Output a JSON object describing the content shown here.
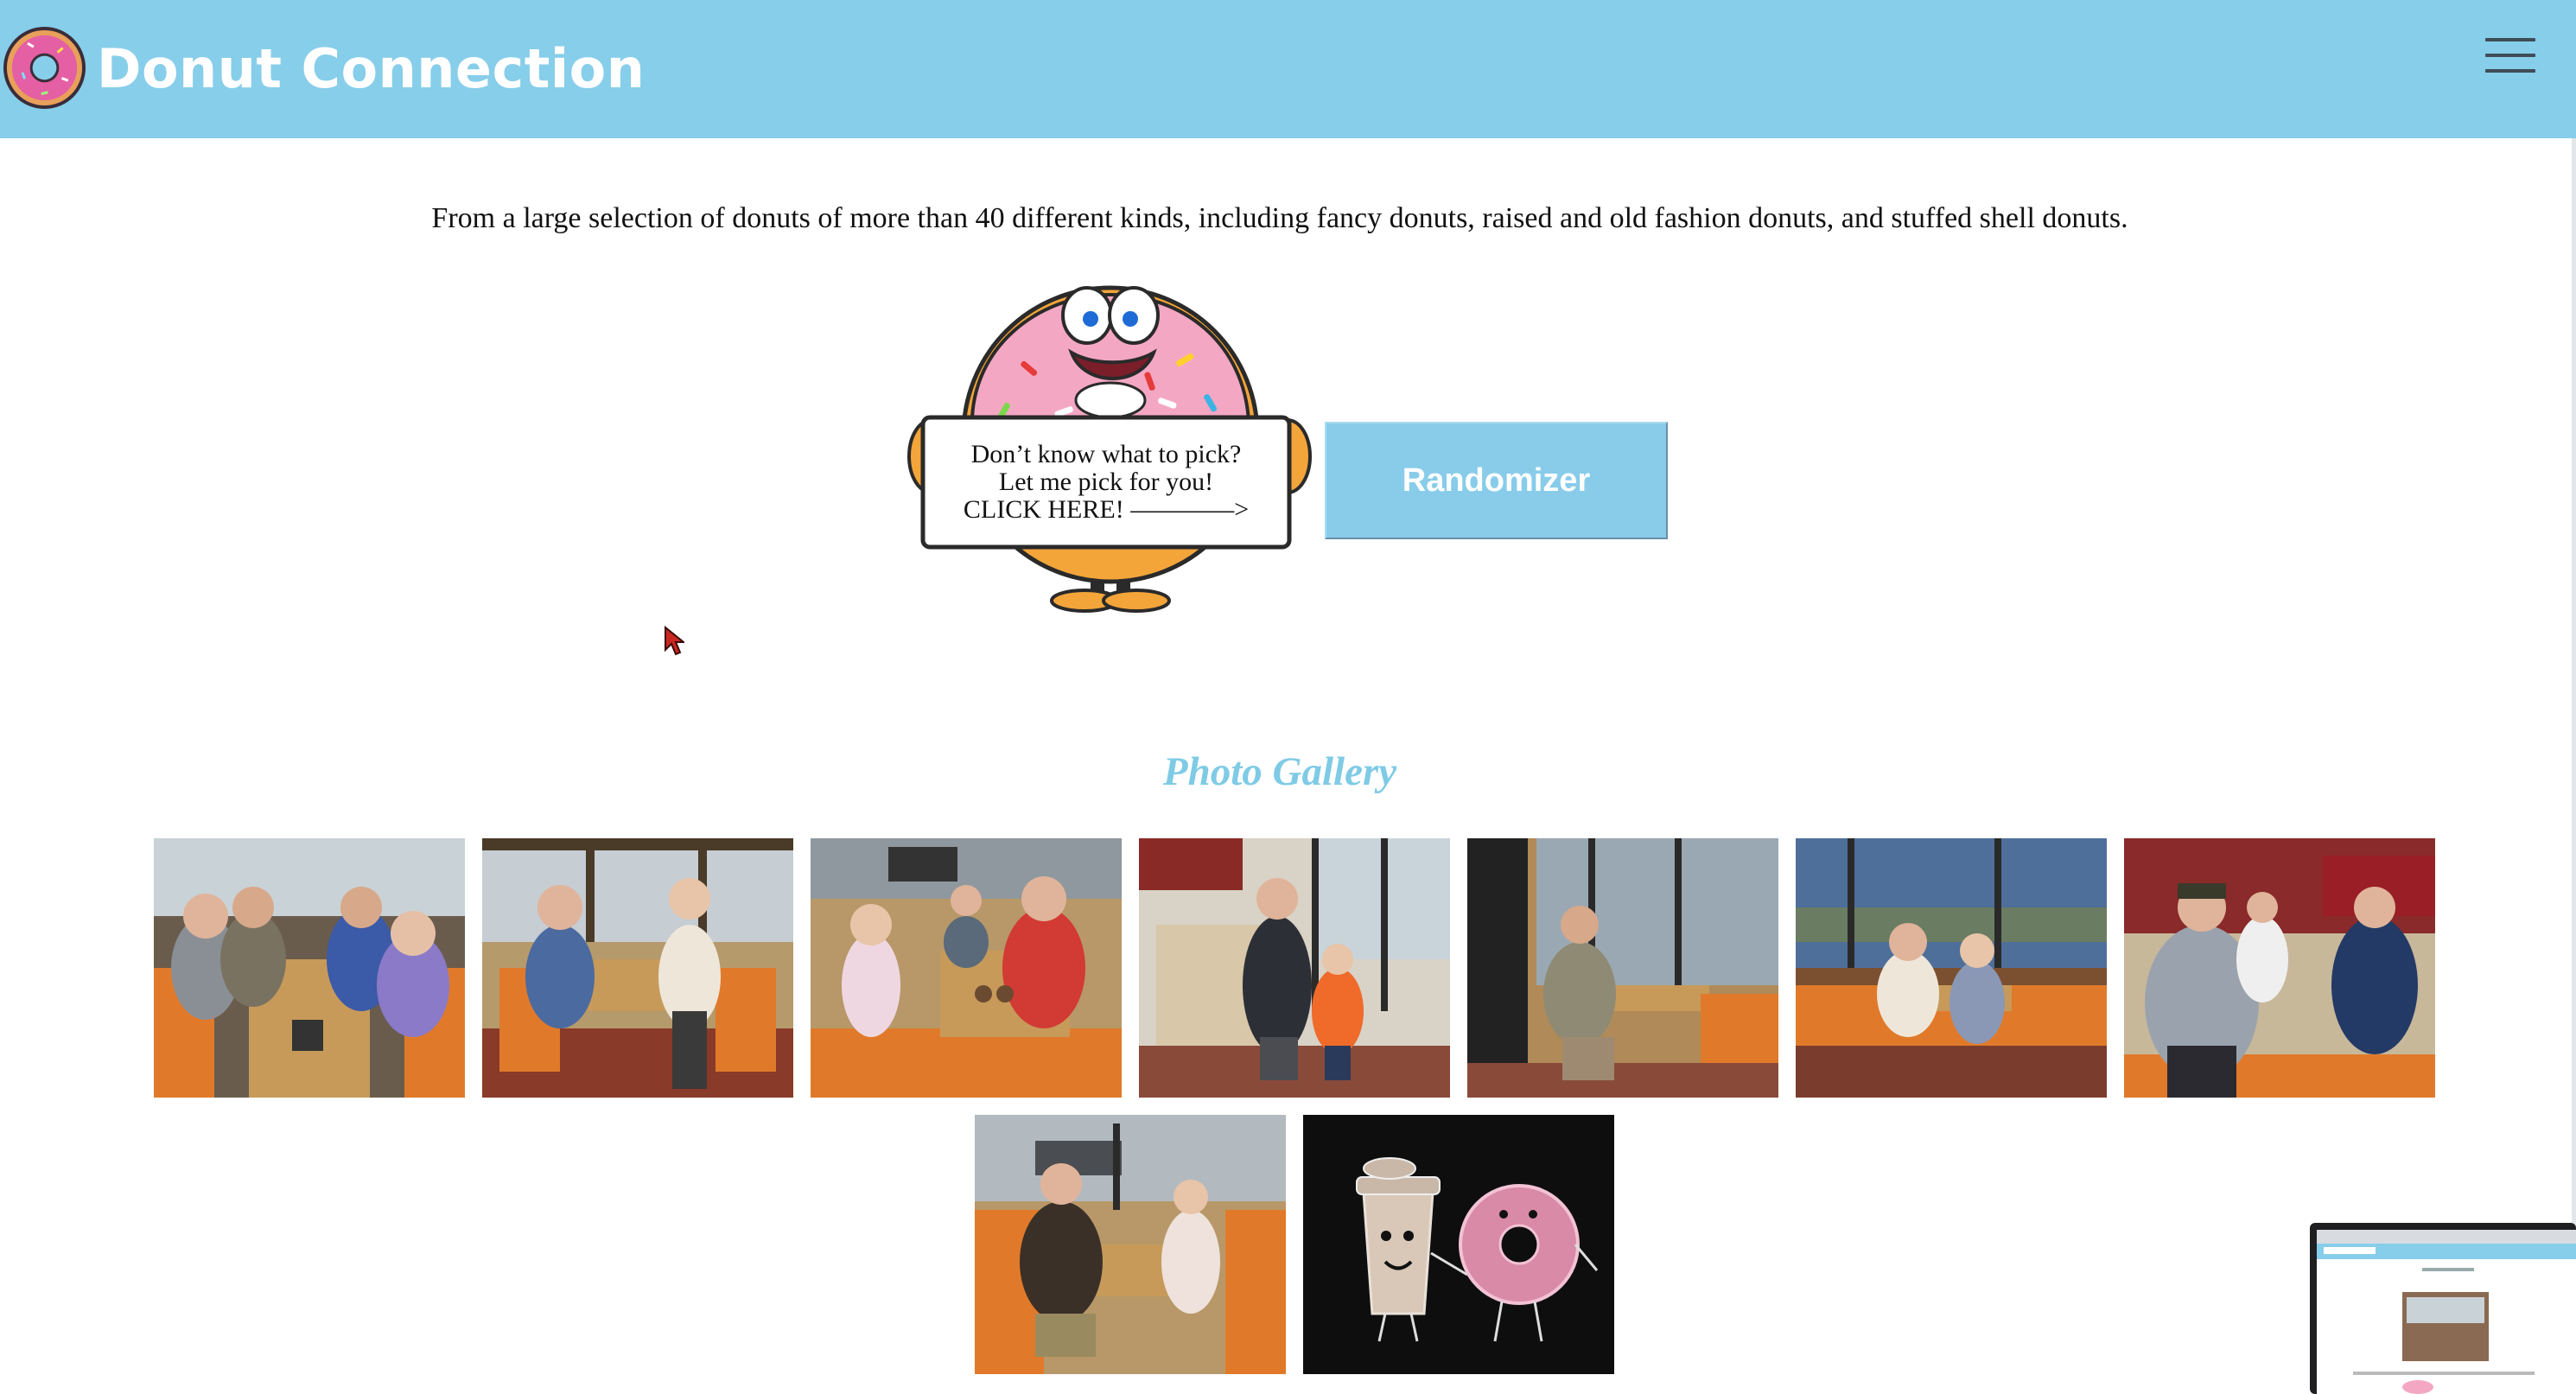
{
  "header": {
    "brand": "Donut Connection",
    "logo_icon": "donut-logo-icon",
    "menu_icon": "hamburger-menu-icon",
    "background": "#87ceea"
  },
  "intro": {
    "text": "From a large selection of donuts of more than 40 different kinds, including fancy donuts, raised and old fashion donuts, and stuffed shell donuts."
  },
  "mascot": {
    "sign_line1": "Don’t know what to pick?",
    "sign_line2": "Let me pick for you!",
    "sign_line3": "CLICK HERE! ————>"
  },
  "randomizer": {
    "label": "Randomizer",
    "color": "#88ccea"
  },
  "gallery": {
    "title": "Photo Gallery",
    "title_color": "#7fcbe6",
    "photos": [
      {
        "subject": "group-of-four-seniors-in-booth"
      },
      {
        "subject": "two-women-at-table"
      },
      {
        "subject": "girl-boy-and-man-in-red-jersey"
      },
      {
        "subject": "man-and-boy-by-counter"
      },
      {
        "subject": "older-man-in-booth"
      },
      {
        "subject": "couple-by-window-evening"
      },
      {
        "subject": "group-of-older-men"
      },
      {
        "subject": "man-and-girl-in-booth"
      },
      {
        "subject": "coffee-cup-and-donut-drawing"
      }
    ]
  },
  "colors": {
    "booth_orange": "#e07a2a",
    "table_wood": "#c79a5a",
    "donut_pink": "#f4a7c3"
  }
}
